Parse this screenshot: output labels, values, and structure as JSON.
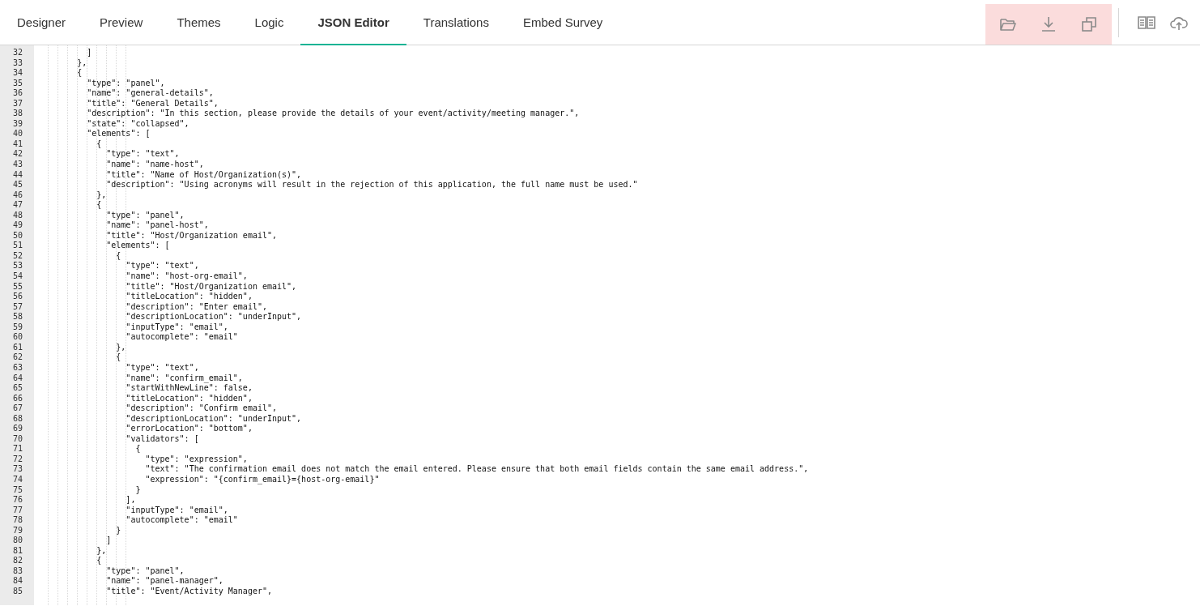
{
  "tabs": [
    {
      "label": "Designer",
      "selected": false
    },
    {
      "label": "Preview",
      "selected": false
    },
    {
      "label": "Themes",
      "selected": false
    },
    {
      "label": "Logic",
      "selected": false
    },
    {
      "label": "JSON Editor",
      "selected": true
    },
    {
      "label": "Translations",
      "selected": false
    },
    {
      "label": "Embed Survey",
      "selected": false
    }
  ],
  "editor": {
    "lines": [
      {
        "number": "32",
        "text": "          ]"
      },
      {
        "number": "33",
        "text": "        },"
      },
      {
        "number": "34",
        "text": "        {"
      },
      {
        "number": "35",
        "text": "          \"type\": \"panel\","
      },
      {
        "number": "36",
        "text": "          \"name\": \"general-details\","
      },
      {
        "number": "37",
        "text": "          \"title\": \"General Details\","
      },
      {
        "number": "38",
        "text": "          \"description\": \"In this section, please provide the details of your event/activity/meeting manager.\","
      },
      {
        "number": "39",
        "text": "          \"state\": \"collapsed\","
      },
      {
        "number": "40",
        "text": "          \"elements\": ["
      },
      {
        "number": "41",
        "text": "            {"
      },
      {
        "number": "42",
        "text": "              \"type\": \"text\","
      },
      {
        "number": "43",
        "text": "              \"name\": \"name-host\","
      },
      {
        "number": "44",
        "text": "              \"title\": \"Name of Host/Organization(s)\","
      },
      {
        "number": "45",
        "text": "              \"description\": \"Using acronyms will result in the rejection of this application, the full name must be used.\""
      },
      {
        "number": "46",
        "text": "            },"
      },
      {
        "number": "47",
        "text": "            {"
      },
      {
        "number": "48",
        "text": "              \"type\": \"panel\","
      },
      {
        "number": "49",
        "text": "              \"name\": \"panel-host\","
      },
      {
        "number": "50",
        "text": "              \"title\": \"Host/Organization email\","
      },
      {
        "number": "51",
        "text": "              \"elements\": ["
      },
      {
        "number": "52",
        "text": "                {"
      },
      {
        "number": "53",
        "text": "                  \"type\": \"text\","
      },
      {
        "number": "54",
        "text": "                  \"name\": \"host-org-email\","
      },
      {
        "number": "55",
        "text": "                  \"title\": \"Host/Organization email\","
      },
      {
        "number": "56",
        "text": "                  \"titleLocation\": \"hidden\","
      },
      {
        "number": "57",
        "text": "                  \"description\": \"Enter email\","
      },
      {
        "number": "58",
        "text": "                  \"descriptionLocation\": \"underInput\","
      },
      {
        "number": "59",
        "text": "                  \"inputType\": \"email\","
      },
      {
        "number": "60",
        "text": "                  \"autocomplete\": \"email\""
      },
      {
        "number": "61",
        "text": "                },"
      },
      {
        "number": "62",
        "text": "                {"
      },
      {
        "number": "63",
        "text": "                  \"type\": \"text\","
      },
      {
        "number": "64",
        "text": "                  \"name\": \"confirm_email\","
      },
      {
        "number": "65",
        "text": "                  \"startWithNewLine\": false,"
      },
      {
        "number": "66",
        "text": "                  \"titleLocation\": \"hidden\","
      },
      {
        "number": "67",
        "text": "                  \"description\": \"Confirm email\","
      },
      {
        "number": "68",
        "text": "                  \"descriptionLocation\": \"underInput\","
      },
      {
        "number": "69",
        "text": "                  \"errorLocation\": \"bottom\","
      },
      {
        "number": "70",
        "text": "                  \"validators\": ["
      },
      {
        "number": "71",
        "text": "                    {"
      },
      {
        "number": "72",
        "text": "                      \"type\": \"expression\","
      },
      {
        "number": "73",
        "text": "                      \"text\": \"The confirmation email does not match the email entered. Please ensure that both email fields contain the same email address.\","
      },
      {
        "number": "74",
        "text": "                      \"expression\": \"{confirm_email}={host-org-email}\""
      },
      {
        "number": "75",
        "text": "                    }"
      },
      {
        "number": "76",
        "text": "                  ],"
      },
      {
        "number": "77",
        "text": "                  \"inputType\": \"email\","
      },
      {
        "number": "78",
        "text": "                  \"autocomplete\": \"email\""
      },
      {
        "number": "79",
        "text": "                }"
      },
      {
        "number": "80",
        "text": "              ]"
      },
      {
        "number": "81",
        "text": "            },"
      },
      {
        "number": "82",
        "text": "            {"
      },
      {
        "number": "83",
        "text": "              \"type\": \"panel\","
      },
      {
        "number": "84",
        "text": "              \"name\": \"panel-manager\","
      },
      {
        "number": "85",
        "text": "              \"title\": \"Event/Activity Manager\","
      }
    ]
  }
}
